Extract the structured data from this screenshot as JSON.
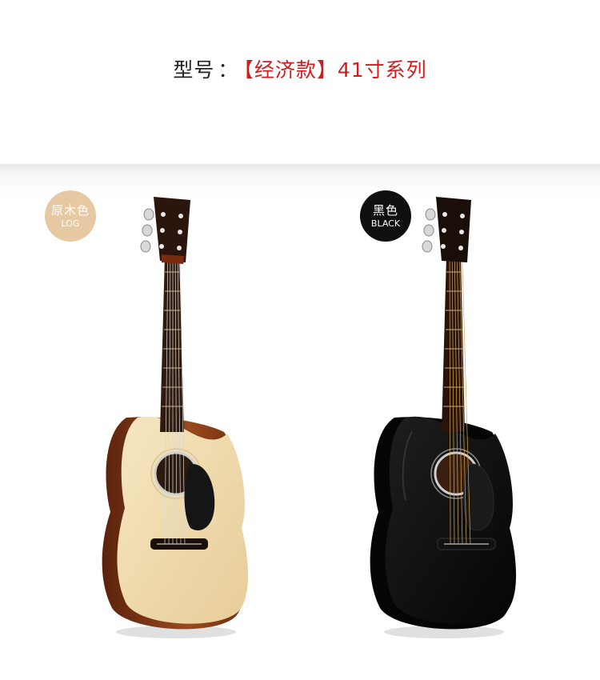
{
  "header": {
    "label": "型号",
    "separator": "：",
    "value": "【经济款】41寸系列"
  },
  "variants": [
    {
      "name_zh": "原木色",
      "name_en": "LOG",
      "badge_color": "#e6c9a2",
      "body_color": "#f0dcae",
      "side_color": "#7a3413"
    },
    {
      "name_zh": "黑色",
      "name_en": "BLACK",
      "badge_color": "#0f0f0f",
      "body_color": "#0c0c0c",
      "side_color": "#050505"
    }
  ],
  "accent_color": "#d7191c"
}
